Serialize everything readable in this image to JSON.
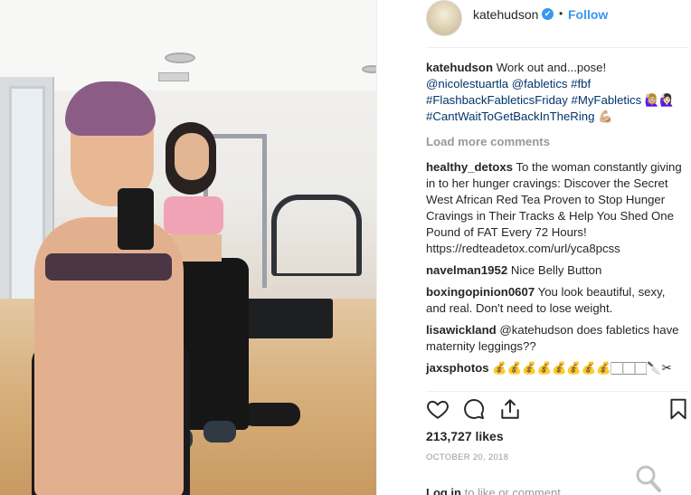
{
  "post": {
    "username": "katehudson",
    "verified_mark": "✔",
    "separator": "•",
    "follow_label": "Follow",
    "caption_user": "katehudson",
    "caption_text": "Work out and...pose!",
    "caption_mentions": "@nicolestuartla @fabletics #fbf",
    "caption_tags": "#FlashbackFableticsFriday #MyFabletics 🙋🏼‍♀️🙋🏻‍♀️ #CantWaitToGetBackInTheRing 💪🏼",
    "load_more": "Load more comments"
  },
  "comments": [
    {
      "user": "healthy_detoxs",
      "text": "To the woman constantly giving in to her hunger cravings: Discover the Secret West African Red Tea Proven to Stop Hunger Cravings in Their Tracks & Help You Shed One Pound of FAT Every 72 Hours! https://redteadetox.com/url/yca8pcss"
    },
    {
      "user": "navelman1952",
      "text": "Nice Belly Button"
    },
    {
      "user": "boxingopinion0607",
      "text": "You look beautiful, sexy, and real. Don't need to lose weight."
    },
    {
      "user": "lisawickland",
      "text": "@katehudson does fabletics have maternity leggings??"
    },
    {
      "user": "jaxsphotos",
      "text": "💰💰💰💰💰💰💰💰🏻🏻🏻🔪✂"
    }
  ],
  "footer": {
    "likes": "213,727 likes",
    "date": "OCTOBER 20, 2018",
    "login_link": "Log in",
    "login_rest": "to like or comment."
  },
  "colors": {
    "accent": "#3897f0",
    "muted": "#999999",
    "text": "#262626"
  },
  "icons": [
    "heart-icon",
    "comment-icon",
    "share-icon",
    "bookmark-icon"
  ]
}
